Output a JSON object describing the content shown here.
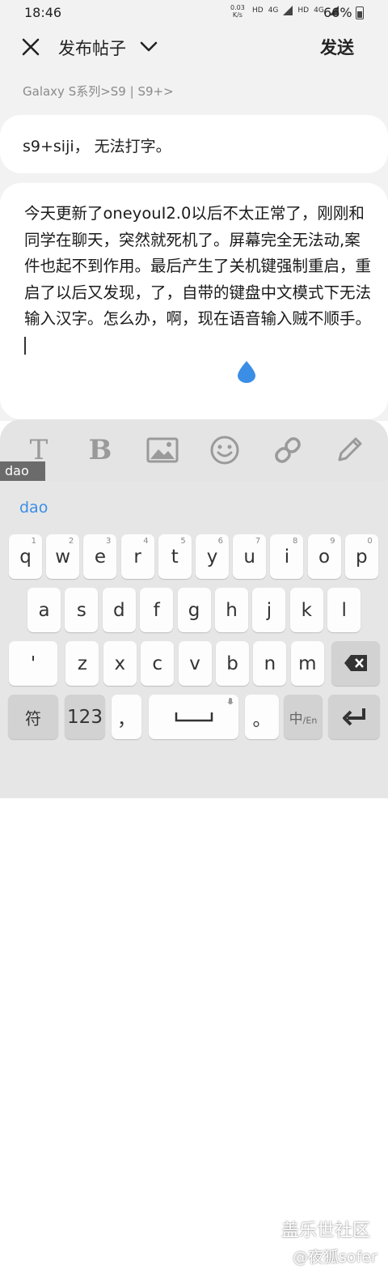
{
  "status": {
    "time": "18:46",
    "speed_value": "0.03",
    "speed_unit": "K/s",
    "net1": "HD",
    "net1_type": "4G",
    "net2": "HD",
    "net2_type": "4G",
    "battery": "66%"
  },
  "header": {
    "title": "发布帖子",
    "send": "发送"
  },
  "breadcrumb": "Galaxy S系列>S9 | S9+>",
  "post": {
    "title": "s9+siji， 无法打字。",
    "body": "今天更新了oneyouI2.0以后不太正常了，刚刚和同学在聊天，突然就死机了。屏幕完全无法动,案件也起不到作用。最后产生了关机键强制重启，重启了以后又发现，了，自带的键盘中文模式下无法输入汉字。怎么办，啊，现在语音输入贼不顺手。"
  },
  "toolbar": {
    "text_style": "T",
    "bold": "B",
    "tooltip": "dao"
  },
  "keyboard": {
    "suggestion": "dao",
    "row1": [
      {
        "k": "q",
        "s": "1"
      },
      {
        "k": "w",
        "s": "2"
      },
      {
        "k": "e",
        "s": "3"
      },
      {
        "k": "r",
        "s": "4"
      },
      {
        "k": "t",
        "s": "5"
      },
      {
        "k": "y",
        "s": "6"
      },
      {
        "k": "u",
        "s": "7"
      },
      {
        "k": "i",
        "s": "8"
      },
      {
        "k": "o",
        "s": "9"
      },
      {
        "k": "p",
        "s": "0"
      }
    ],
    "row2": [
      "a",
      "s",
      "d",
      "f",
      "g",
      "h",
      "j",
      "k",
      "l"
    ],
    "row3": [
      "'",
      "z",
      "x",
      "c",
      "v",
      "b",
      "n",
      "m"
    ],
    "symbols_key": "符",
    "numbers_key": "123",
    "comma_key": "，",
    "period_key": "。",
    "lang_key_main": "中",
    "lang_key_sub": "/En"
  },
  "watermark": {
    "line1": "盖乐世社区",
    "line2": "@夜狐sofer"
  }
}
